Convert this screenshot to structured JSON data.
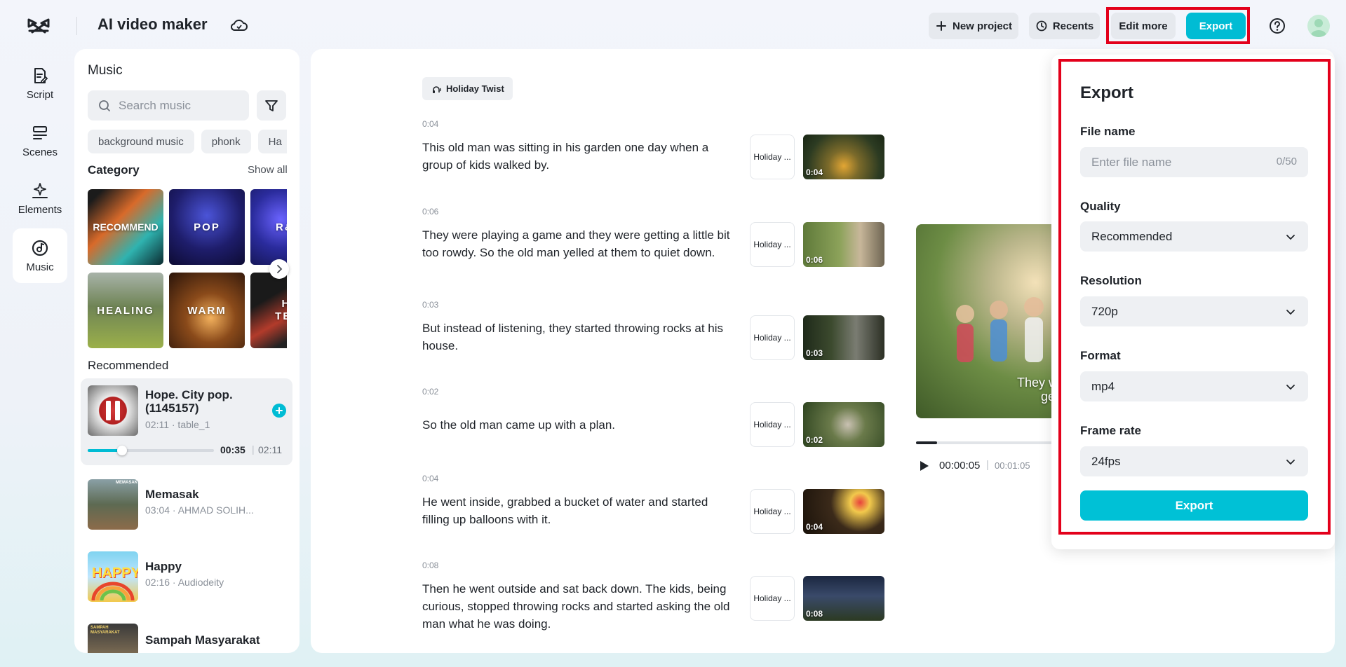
{
  "header": {
    "app_title": "AI video maker",
    "new_project_label": "New project",
    "recents_label": "Recents",
    "edit_more_label": "Edit more",
    "export_label": "Export"
  },
  "nav": {
    "items": [
      {
        "label": "Script",
        "icon": "script-icon"
      },
      {
        "label": "Scenes",
        "icon": "scenes-icon"
      },
      {
        "label": "Elements",
        "icon": "elements-icon"
      },
      {
        "label": "Music",
        "icon": "music-icon"
      }
    ],
    "active": "Music"
  },
  "music": {
    "title": "Music",
    "search_placeholder": "Search music",
    "chips": [
      "background music",
      "phonk",
      "Ha"
    ],
    "category_label": "Category",
    "show_all": "Show all",
    "categories": [
      "RECOMMEND",
      "POP",
      "R&",
      "HEALING",
      "WARM",
      "HI TEM"
    ],
    "recommended_label": "Recommended",
    "tracks": [
      {
        "name": "Hope. City pop. (1145157)",
        "meta": "02:11 · table_1"
      },
      {
        "name": "Memasak",
        "meta": "03:04 · AHMAD SOLIH..."
      },
      {
        "name": "Happy",
        "meta": "02:16 · Audiodeity"
      },
      {
        "name": "Sampah Masyarakat",
        "meta": ""
      }
    ],
    "thumb_texts": {
      "memasak": "MEMASAK",
      "happy": "HAPPY",
      "sampah": "SAMPAH MASYARAKAT"
    },
    "player": {
      "current": "00:35",
      "separator": "|",
      "total": "02:11",
      "progress": 0.27
    }
  },
  "script": {
    "voice_tag": "Holiday Twist",
    "scene_tag_label": "Holiday ...",
    "scenes": [
      {
        "duration": "0:04",
        "text": "This old man was sitting in his garden one day when a group of kids walked by.",
        "thumb_duration": "0:04"
      },
      {
        "duration": "0:06",
        "text": "They were playing a game and they were getting a little bit too rowdy. So the old man yelled at them to quiet down.",
        "thumb_duration": "0:06"
      },
      {
        "duration": "0:03",
        "text": "But instead of listening, they started throwing rocks at his house.",
        "thumb_duration": "0:03"
      },
      {
        "duration": "0:02",
        "text": "So the old man came up with a plan.",
        "thumb_duration": "0:02"
      },
      {
        "duration": "0:04",
        "text": "He went inside, grabbed a bucket of water and started filling up balloons with it.",
        "thumb_duration": "0:04"
      },
      {
        "duration": "0:08",
        "text": "Then he went outside and sat back down. The kids, being curious, stopped throwing rocks and started asking the old man what he was doing.",
        "thumb_duration": "0:08"
      }
    ]
  },
  "preview": {
    "caption_line1": "They were play",
    "caption_line2": "getting",
    "current": "00:00:05",
    "separator": "|",
    "total": "00:01:05",
    "progress": 0.1
  },
  "export_panel": {
    "title": "Export",
    "file_name_label": "File name",
    "file_name_placeholder": "Enter file name",
    "file_name_counter": "0/50",
    "quality_label": "Quality",
    "quality_value": "Recommended",
    "resolution_label": "Resolution",
    "resolution_value": "720p",
    "format_label": "Format",
    "format_value": "mp4",
    "frame_rate_label": "Frame rate",
    "frame_rate_value": "24fps",
    "export_button": "Export"
  },
  "colors": {
    "accent": "#00bcd4",
    "highlight": "#e3001b"
  }
}
